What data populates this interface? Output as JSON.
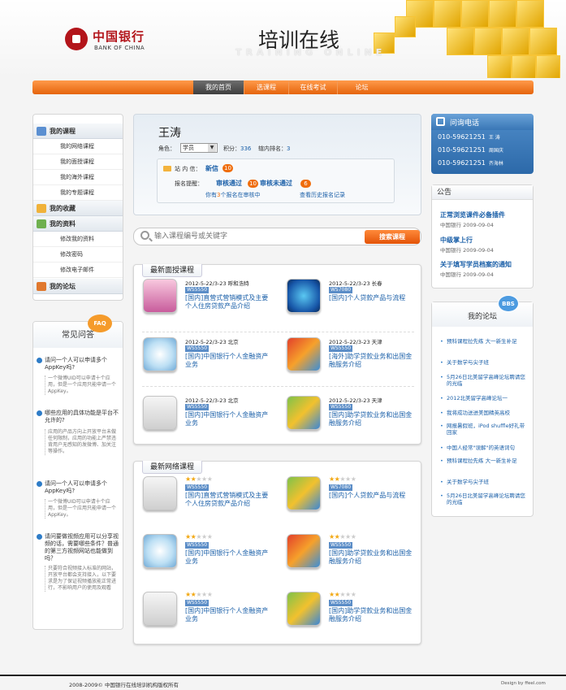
{
  "header": {
    "logo_cn": "中国银行",
    "logo_en": "BANK OF CHINA",
    "title": "培训在线",
    "subtitle": "TRAINING ONLINE"
  },
  "nav": {
    "items": [
      {
        "label": "我的首页",
        "active": true
      },
      {
        "label": "选课程",
        "active": false
      },
      {
        "label": "在线考试",
        "active": false
      },
      {
        "label": "论坛",
        "active": false
      }
    ]
  },
  "left_menu": {
    "groups": [
      {
        "title": "我的课程",
        "icon": "book-icon",
        "items": [
          "我的网络课程",
          "我的面授课程",
          "我的海外课程",
          "我的专题课程"
        ]
      },
      {
        "title": "我的收藏",
        "icon": "tag-icon",
        "items": []
      },
      {
        "title": "我的资料",
        "icon": "user-icon",
        "items": [
          "修改我的资料",
          "修改密码",
          "修改电子邮件"
        ]
      },
      {
        "title": "我的论坛",
        "icon": "chat-icon",
        "items": []
      }
    ]
  },
  "faq": {
    "title": "常见问答",
    "badge": "FAQ",
    "items": [
      {
        "q": "请问一个人可以申请多个AppKey吗?",
        "a": "一个微博UID可以申请十个应用，但是一个应用只能申请一个AppKey。"
      },
      {
        "q": "哪些应用的具体功能是平台不允许的?",
        "a": "应用的产品方向上开放平台未做任何限制，应用的功能上严禁违背用户无感知的发微博、加关注等操作。"
      },
      {
        "q": "请问一个人可以申请多个AppKey吗?",
        "a": "一个微博UID可以申请十个应用，但是一个应用只能申请一个AppKey。"
      },
      {
        "q": "请问要做视频应用可以分享视频的话，需要哪些条件？普通的第三方视频网站也能做到吗？",
        "a": "只要符合视频接入标准的网站，开放平台都会支持接入，以下要求是为了保证视频播放能正常进行，不影响用户的使用及观看"
      }
    ]
  },
  "profile": {
    "name": "王涛",
    "role_label": "角色：",
    "role_value": "学员",
    "score_label": "积分：",
    "score_value": "336",
    "rank_label": "辖内排名：",
    "rank_value": "3",
    "msg_label": "站 内 信：",
    "msg_new": "新信",
    "msg_count": "10",
    "remind_label": "报名提醒：",
    "pass_label": "审核通过",
    "pass_count": "10",
    "fail_label": "审核未通过",
    "fail_count": "6",
    "pending_pre": "你有",
    "pending_count": "3",
    "pending_post": "个报名在审核中",
    "history": "查看历史报名记录"
  },
  "search": {
    "placeholder": "输入课程编号或关键字",
    "button": "搜索课程"
  },
  "face_courses": {
    "title": "最新面授课程",
    "items": [
      {
        "date": "2012-5-22/3-23",
        "city": "呼和浩特",
        "code": "WS5550",
        "title": "[国内]直营式营销模式及主要个人住房贷款产品介绍",
        "icon": "folder-pink-icon"
      },
      {
        "date": "2012-5-22/3-23",
        "city": "长春",
        "code": "WS7080",
        "title": "[国内]个人贷款产品与流程",
        "icon": "globe-icon"
      },
      {
        "date": "2012-5-22/3-23",
        "city": "北京",
        "code": "WS5550",
        "title": "[国内]中国银行个人金融资产业务",
        "icon": "compass-icon"
      },
      {
        "date": "2012-5-22/3-23",
        "city": "天津",
        "code": "WS5550",
        "title": "[海外]助学贷款业务和出国金融服务介绍",
        "icon": "chart-icon"
      },
      {
        "date": "2012-5-22/3-23",
        "city": "北京",
        "code": "WS5550",
        "title": "[国内]中国银行个人金融资产业务",
        "icon": "house-icon"
      },
      {
        "date": "2012-5-22/3-23",
        "city": "天津",
        "code": "WS5550",
        "title": "[国内]助学贷款业务和出国金融服务介绍",
        "icon": "books-icon"
      }
    ]
  },
  "online_courses": {
    "title": "最新网络课程",
    "items": [
      {
        "rating": 2,
        "code": "WS5550",
        "title": "[国内]直营式营销模式及主要个人住房贷款产品介绍",
        "icon": "house-icon"
      },
      {
        "rating": 2,
        "code": "WS7080",
        "title": "[国内]个人贷款产品与流程",
        "icon": "books-icon"
      },
      {
        "rating": 2,
        "code": "WS5550",
        "title": "[国内]中国银行个人金融资产业务",
        "icon": "compass-icon"
      },
      {
        "rating": 2,
        "code": "WS5550",
        "title": "[国内]助学贷款业务和出国金融服务介绍",
        "icon": "chart-icon"
      },
      {
        "rating": 2,
        "code": "WS5550",
        "title": "[国内]中国银行个人金融资产业务",
        "icon": "house-icon"
      },
      {
        "rating": 2,
        "code": "WS5550",
        "title": "[国内]助学贷款业务和出国金融服务介绍",
        "icon": "books-icon"
      }
    ]
  },
  "hotline": {
    "title": "问询电话",
    "phones": [
      {
        "number": "010-59621251",
        "name": "王 涛"
      },
      {
        "number": "010-59621251",
        "name": "周国庆"
      },
      {
        "number": "010-59621251",
        "name": "齐海林"
      }
    ]
  },
  "notice": {
    "title": "公告",
    "items": [
      {
        "title": "正常浏览课件必备插件",
        "meta": "中国银行 2009-09-04"
      },
      {
        "title": "中级掌上行",
        "meta": "中国银行 2009-09-04"
      },
      {
        "title": "关于填写学员档案的通知",
        "meta": "中国银行 2009-09-04"
      }
    ]
  },
  "forum": {
    "title": "我的论坛",
    "badge": "BBS",
    "items": [
      "预科课程拉先练 大一新生补足",
      "关于数学与尖子班",
      "5月26日北美留学高峰论坛聘请您的光临",
      "2012北美留学高峰论坛一",
      "我将成功送进美国精英高校",
      "网报暑假班，iPod shuffle好礼带回家",
      "中国人经常\"误解\"的英语词句",
      "预科课程拉先练 大一新生补足",
      "关于数学与尖子班",
      "5月26日北美留学高峰论坛聘请您的光临"
    ]
  },
  "footer": {
    "copyright": "2008-2009© 中国银行在线培训机构版权所有",
    "design": "Design by ffeel.com"
  },
  "colors": {
    "accent": "#e5640c",
    "link": "#1a5fa8",
    "brand": "#b3151b"
  }
}
